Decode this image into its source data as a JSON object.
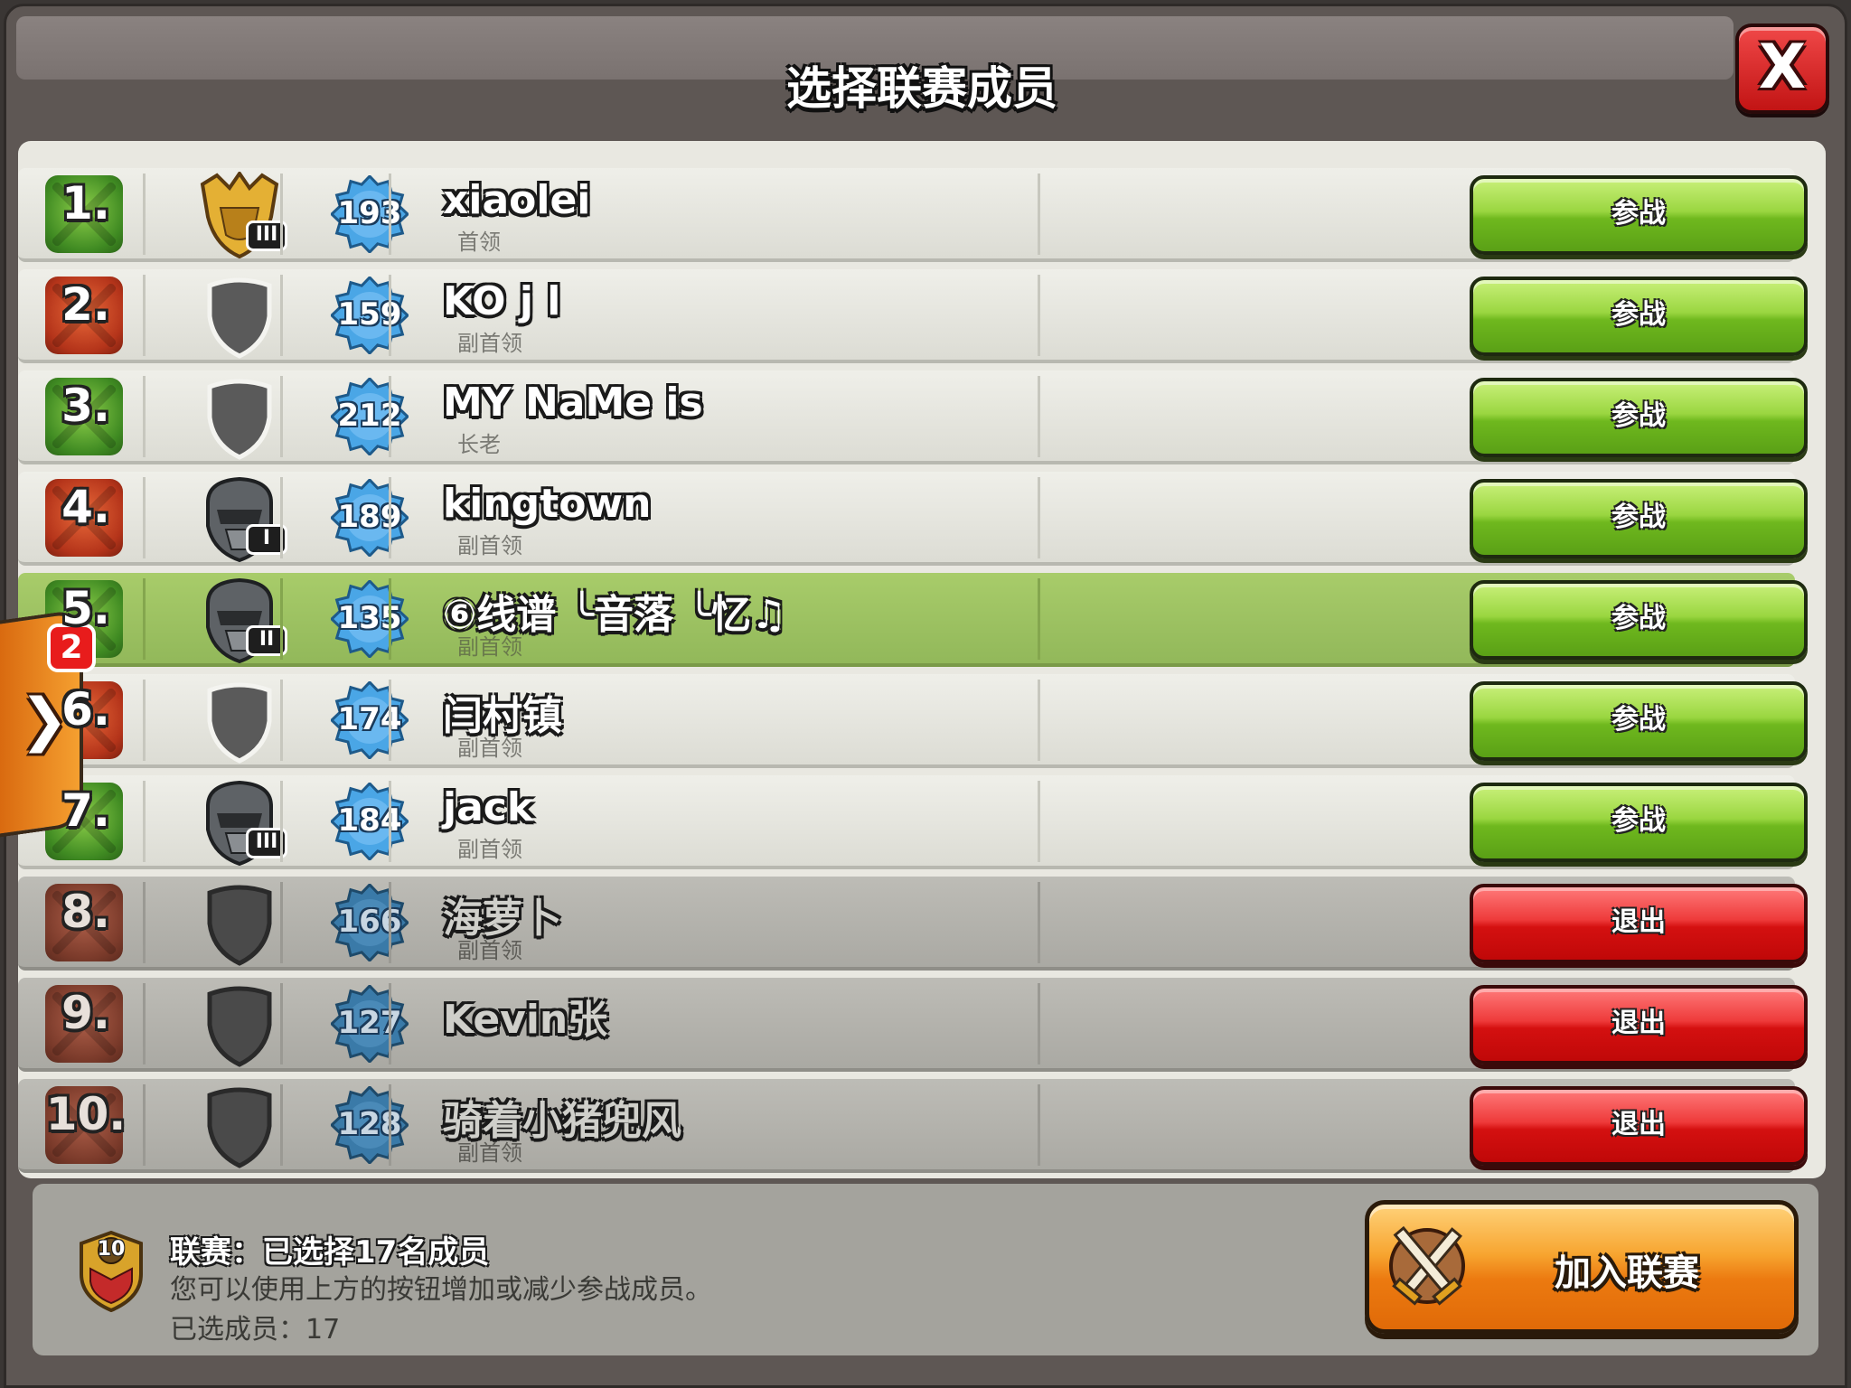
{
  "header": {
    "title": "选择联赛成员",
    "close_label": "X"
  },
  "side_tab": {
    "count": "2",
    "arrow": "❯"
  },
  "buttons": {
    "join": "参战",
    "leave": "退出"
  },
  "members": [
    {
      "rank": "1.",
      "name": "xiaolei",
      "role": "首领",
      "level": "193",
      "league": "gold",
      "tier": "III",
      "status": "in"
    },
    {
      "rank": "2.",
      "name": "KO j l",
      "role": "副首领",
      "level": "159",
      "league": "none",
      "tier": "",
      "status": "in"
    },
    {
      "rank": "3.",
      "name": "MY NaMe is",
      "role": "长老",
      "level": "212",
      "league": "none",
      "tier": "",
      "status": "in"
    },
    {
      "rank": "4.",
      "name": "kingtown",
      "role": "副首领",
      "level": "189",
      "league": "silver",
      "tier": "I",
      "status": "in"
    },
    {
      "rank": "5.",
      "name": "⑥线谱 ╰音落 ╰忆♫",
      "role": "副首领",
      "level": "135",
      "league": "silver",
      "tier": "II",
      "status": "in"
    },
    {
      "rank": "6.",
      "name": "闫村镇",
      "role": "副首领",
      "level": "174",
      "league": "none",
      "tier": "",
      "status": "in"
    },
    {
      "rank": "7.",
      "name": "jack",
      "role": "副首领",
      "level": "184",
      "league": "silver",
      "tier": "III",
      "status": "in"
    },
    {
      "rank": "8.",
      "name": "海萝卜",
      "role": "副首领",
      "level": "166",
      "league": "none",
      "tier": "",
      "status": "out"
    },
    {
      "rank": "9.",
      "name": "Kevin张",
      "role": "",
      "level": "127",
      "league": "none",
      "tier": "",
      "status": "out"
    },
    {
      "rank": "10.",
      "name": "骑着小猪兜风",
      "role": "副首领",
      "level": "128",
      "league": "none",
      "tier": "",
      "status": "out"
    }
  ],
  "footer": {
    "clan_level": "10",
    "line1": "联赛：已选择17名成员",
    "line2": "您可以使用上方的按钮增加或减少参战成员。",
    "line3": "已选成员：17",
    "join_league_label": "加入联赛"
  },
  "colors": {
    "join_green": "#8ccd34",
    "leave_red": "#d91a1a",
    "highlight_row": "#9dc264",
    "orange_button": "#ef8a1c"
  }
}
